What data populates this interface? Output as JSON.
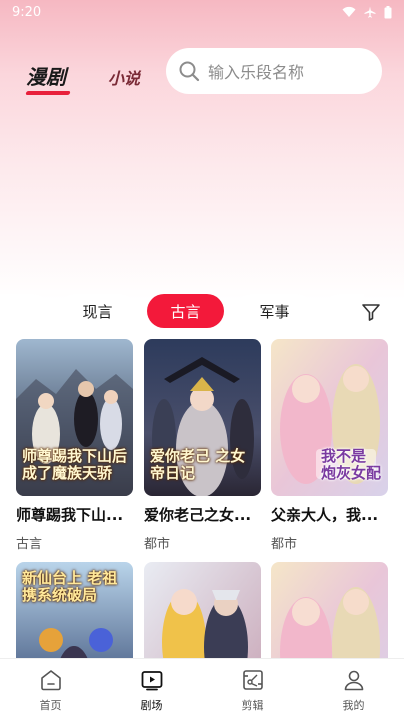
{
  "status": {
    "time": "9:20"
  },
  "header": {
    "tabs": [
      {
        "label": "漫剧",
        "active": true
      },
      {
        "label": "小说",
        "active": false
      }
    ],
    "search": {
      "placeholder": "输入乐段名称"
    }
  },
  "categories": {
    "items": [
      "",
      "现言",
      "古言",
      "军事",
      ""
    ],
    "selected": "古言"
  },
  "colors": {
    "accent": "#f3193a"
  },
  "cards": [
    {
      "title": "师尊踢我下山...",
      "genre": "古言",
      "cover_text": "师尊踢我下山后 成了魔族天骄"
    },
    {
      "title": "爱你老己之女...",
      "genre": "都市",
      "cover_text": "爱你老己 之女帝日记"
    },
    {
      "title": "父亲大人，我...",
      "genre": "都市",
      "cover_text": "我不是 炮灰女配"
    },
    {
      "title": "",
      "genre": "",
      "cover_text": "新仙台上 老祖携系统破局"
    },
    {
      "title": "",
      "genre": "",
      "cover_text": ""
    },
    {
      "title": "",
      "genre": "",
      "cover_text": ""
    }
  ],
  "bottom_nav": [
    {
      "label": "首页",
      "icon": "home-icon",
      "active": false
    },
    {
      "label": "剧场",
      "icon": "play-screen-icon",
      "active": true
    },
    {
      "label": "剪辑",
      "icon": "clip-edit-icon",
      "active": false
    },
    {
      "label": "我的",
      "icon": "profile-icon",
      "active": false
    }
  ]
}
